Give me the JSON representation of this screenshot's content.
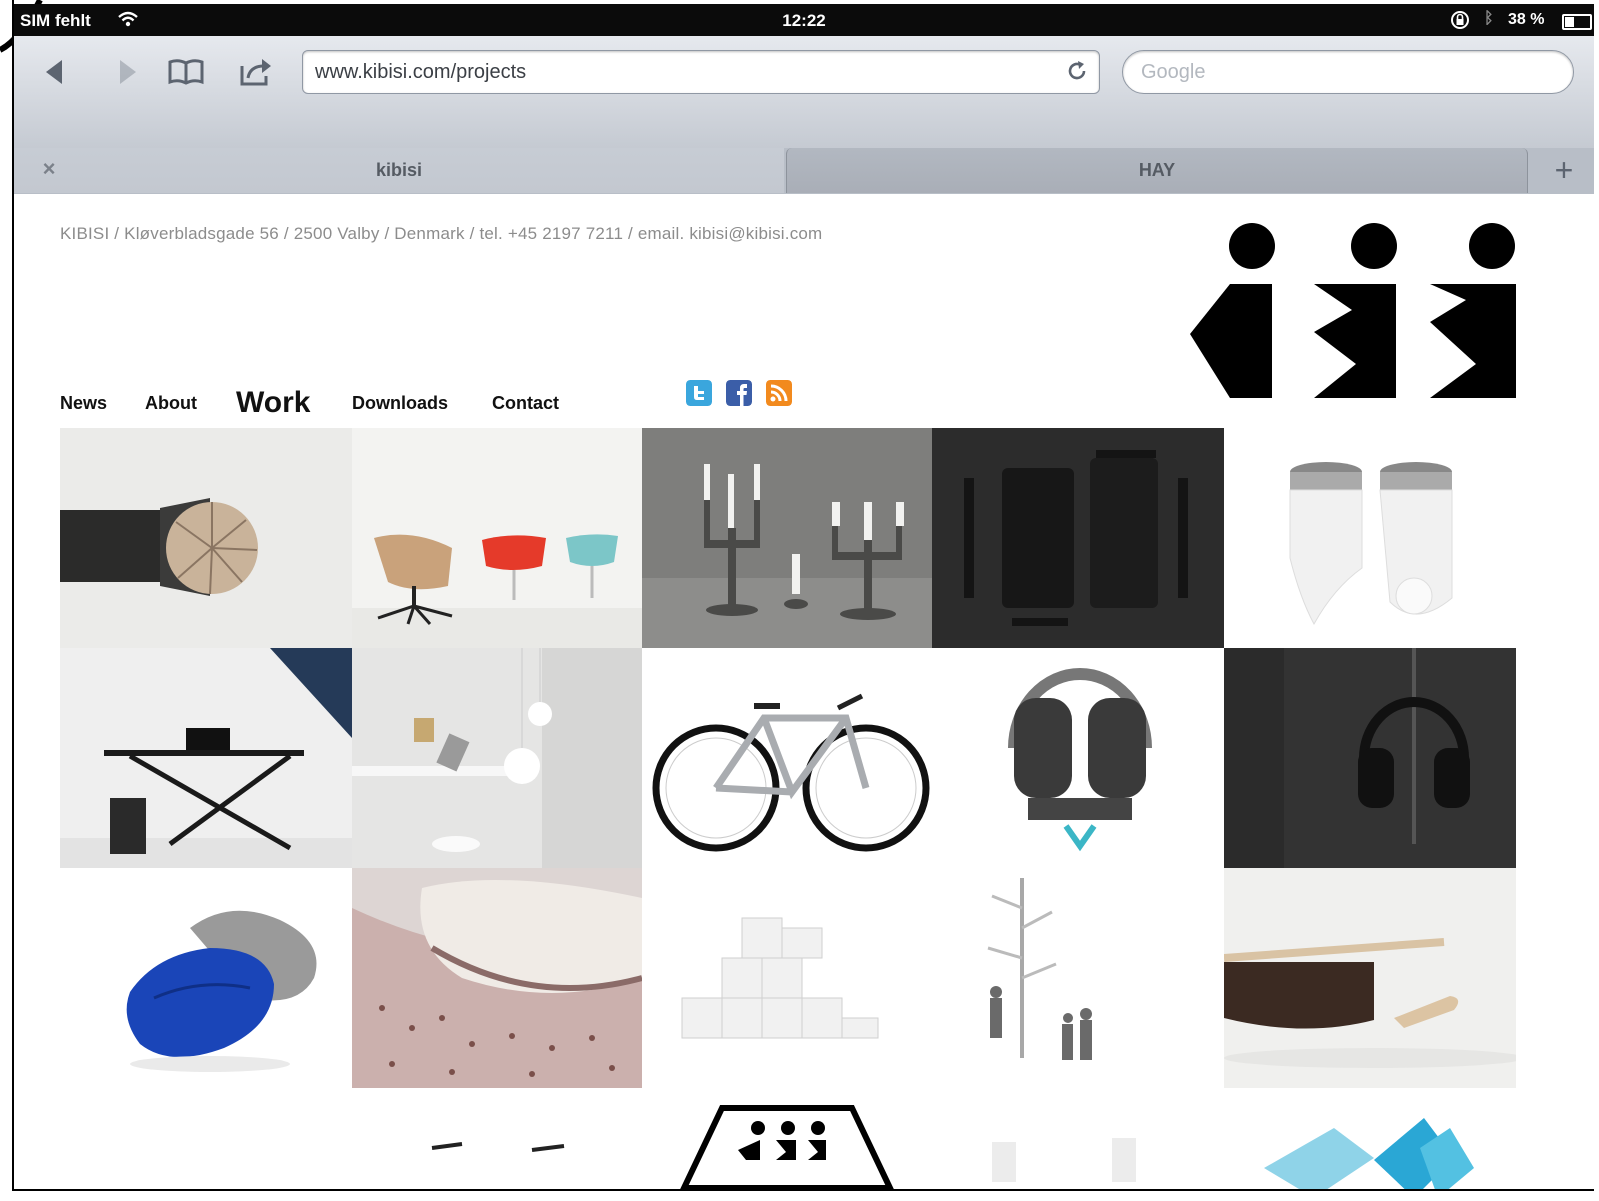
{
  "status_bar": {
    "carrier": "SIM fehlt",
    "time": "12:22",
    "battery": "38 %"
  },
  "toolbar": {
    "url": "www.kibisi.com/projects",
    "search_placeholder": "Google"
  },
  "tabs": [
    {
      "label": "kibisi",
      "active": true
    },
    {
      "label": "HAY",
      "active": false
    }
  ],
  "page": {
    "contact_line": "KIBISI / Kløverbladsgade 56 / 2500 Valby / Denmark / tel. +45 2197 7211 / email. kibisi@kibisi.com",
    "nav": [
      {
        "label": "News"
      },
      {
        "label": "About"
      },
      {
        "label": "Work",
        "current": true
      },
      {
        "label": "Downloads"
      },
      {
        "label": "Contact"
      }
    ],
    "social": [
      {
        "icon": "twitter-icon",
        "color": "#3aa6dd"
      },
      {
        "icon": "facebook-icon",
        "color": "#3b5ea8"
      },
      {
        "icon": "rss-icon",
        "color": "#f28a1e"
      }
    ],
    "grid_tiles": [
      "wooden-pendant-lamp",
      "lounge-chairs",
      "candelabras",
      "phone-cases",
      "speakers",
      "desk",
      "lamps-room",
      "bicycle",
      "headphones-white",
      "headphones-dark",
      "blue-pouf",
      "cushion-detail",
      "shelving",
      "tree-sculpture",
      "pan-with-lid",
      "stool-pair",
      "kibisi-logo-tile",
      "white-objects",
      "blue-chairs"
    ]
  }
}
